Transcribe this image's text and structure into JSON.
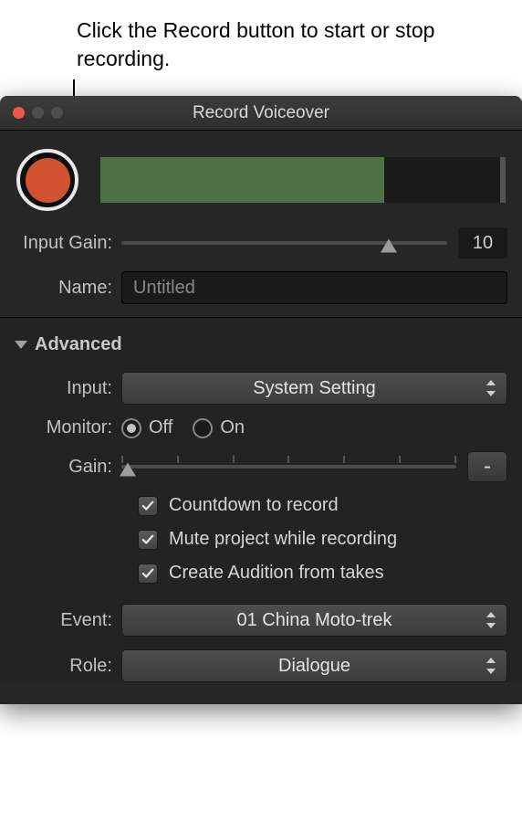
{
  "callout": "Click the Record button to start or stop recording.",
  "window": {
    "title": "Record Voiceover"
  },
  "labels": {
    "input_gain": "Input Gain:",
    "name": "Name:",
    "advanced": "Advanced",
    "input": "Input:",
    "monitor": "Monitor:",
    "gain": "Gain:",
    "event": "Event:",
    "role": "Role:"
  },
  "values": {
    "input_gain": "10",
    "name_placeholder": "Untitled",
    "input_select": "System Setting",
    "monitor_off": "Off",
    "monitor_on": "On",
    "monitor_selected": "off",
    "gain_value": "-",
    "event_select": "01 China Moto-trek",
    "role_select": "Dialogue"
  },
  "checks": {
    "countdown": "Countdown to record",
    "mute": "Mute project while recording",
    "audition": "Create Audition from takes"
  }
}
